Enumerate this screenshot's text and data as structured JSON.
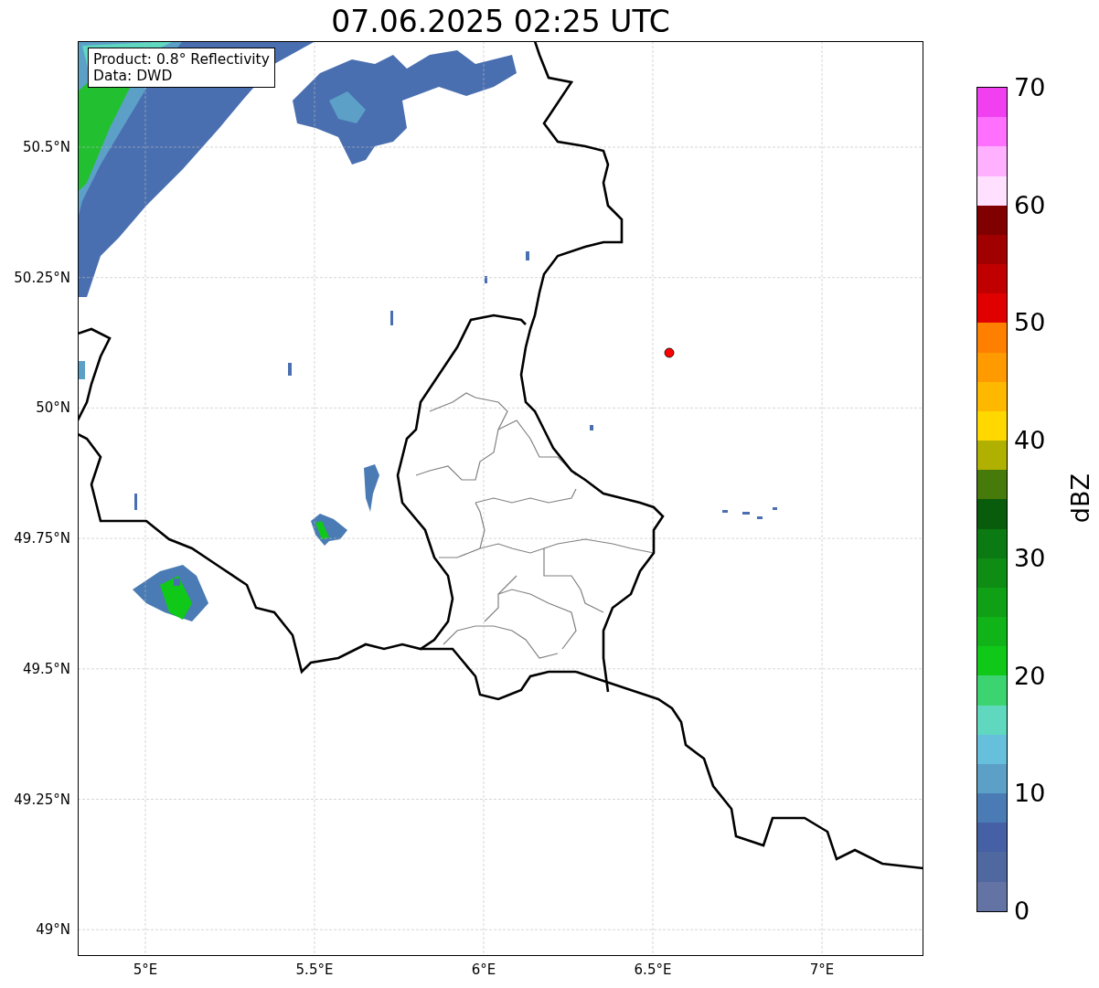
{
  "title": "07.06.2025 02:25 UTC",
  "info_box": {
    "lines": [
      "Product: 0.8° Reflectivity",
      "Data: DWD"
    ]
  },
  "map": {
    "xticks": [
      "5°E",
      "5.5°E",
      "6°E",
      "6.5°E",
      "7°E"
    ],
    "yticks": [
      "50.5°N",
      "50.25°N",
      "50°N",
      "49.75°N",
      "49.5°N",
      "49.25°N",
      "49°N"
    ]
  },
  "colorbar": {
    "label": "dBZ",
    "ticks": [
      "70",
      "60",
      "50",
      "40",
      "30",
      "20",
      "10",
      "0"
    ],
    "segments": [
      {
        "color": "#f040f0"
      },
      {
        "color": "#ff70ff"
      },
      {
        "color": "#ffb0ff"
      },
      {
        "color": "#ffe0ff"
      },
      {
        "color": "#800000"
      },
      {
        "color": "#a00000"
      },
      {
        "color": "#c00000"
      },
      {
        "color": "#e00000"
      },
      {
        "color": "#ff7f00"
      },
      {
        "color": "#ff9a00"
      },
      {
        "color": "#ffb800"
      },
      {
        "color": "#ffd800"
      },
      {
        "color": "#b0b000"
      },
      {
        "color": "#467a0a"
      },
      {
        "color": "#085c0c"
      },
      {
        "color": "#0b7a12"
      },
      {
        "color": "#0e8c14"
      },
      {
        "color": "#0fa016"
      },
      {
        "color": "#10b418"
      },
      {
        "color": "#10c818"
      },
      {
        "color": "#3cd470"
      },
      {
        "color": "#60d8c0"
      },
      {
        "color": "#66c0dc"
      },
      {
        "color": "#5ca0c8"
      },
      {
        "color": "#4a7bb4"
      },
      {
        "color": "#4560a4"
      },
      {
        "color": "#5068a0"
      },
      {
        "color": "#6374a4"
      }
    ]
  }
}
